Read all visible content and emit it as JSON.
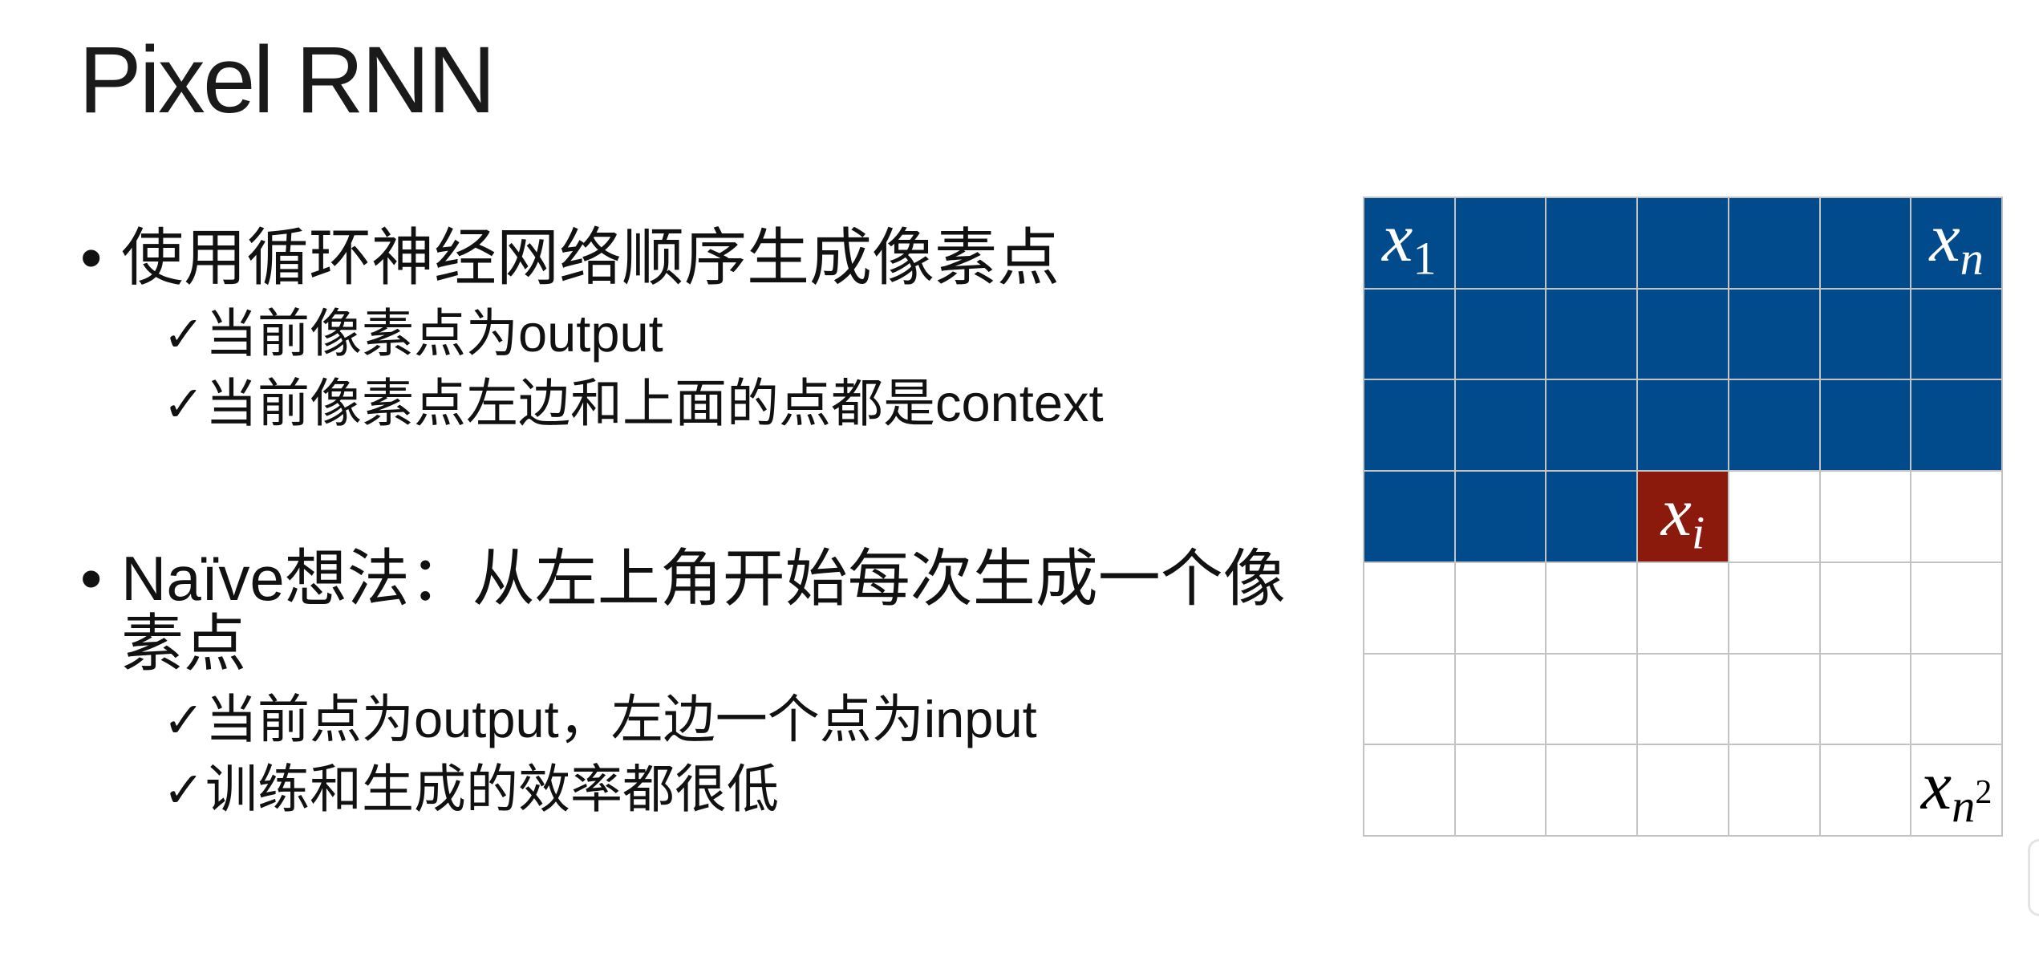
{
  "slide": {
    "title": "Pixel RNN",
    "bullet_glyph": "•",
    "check_glyph": "✓",
    "bullets": [
      {
        "text": "使用循环神经网络顺序生成像素点",
        "subs": [
          "当前像素点为output",
          "当前像素点左边和上面的点都是context"
        ]
      },
      {
        "text": "Naïve想法：从左上角开始每次生成一个像素点",
        "subs": [
          "当前点为output，左边一个点为input",
          "训练和生成的效率都很低"
        ]
      }
    ]
  },
  "pixel_grid": {
    "gridline_color": "#c3c3c3",
    "cell_colors": [
      [
        "#014a8b",
        "#014a8b",
        "#014a8b",
        "#014a8b",
        "#014a8b",
        "#014a8b",
        "#014a8b"
      ],
      [
        "#014a8b",
        "#014a8b",
        "#014a8b",
        "#014a8b",
        "#014a8b",
        "#014a8b",
        "#014a8b"
      ],
      [
        "#014a8b",
        "#014a8b",
        "#014a8b",
        "#014a8b",
        "#014a8b",
        "#014a8b",
        "#014a8b"
      ],
      [
        "#014a8b",
        "#014a8b",
        "#014a8b",
        "#8b190c",
        "#ffffff",
        "#ffffff",
        "#ffffff"
      ],
      [
        "#ffffff",
        "#ffffff",
        "#ffffff",
        "#ffffff",
        "#ffffff",
        "#ffffff",
        "#ffffff"
      ],
      [
        "#ffffff",
        "#ffffff",
        "#ffffff",
        "#ffffff",
        "#ffffff",
        "#ffffff",
        "#ffffff"
      ],
      [
        "#ffffff",
        "#ffffff",
        "#ffffff",
        "#ffffff",
        "#ffffff",
        "#ffffff",
        "#ffffff"
      ]
    ],
    "labels": [
      {
        "row": 0,
        "col": 0,
        "base": "x",
        "sub": "1",
        "color": "#ffffff"
      },
      {
        "row": 0,
        "col": 6,
        "base": "x",
        "sub": "n",
        "color": "#ffffff"
      },
      {
        "row": 3,
        "col": 3,
        "base": "x",
        "sub": "i",
        "color": "#ffffff"
      },
      {
        "row": 6,
        "col": 6,
        "base": "x",
        "sub": "n",
        "sup": "2",
        "color": "#000000"
      }
    ]
  }
}
